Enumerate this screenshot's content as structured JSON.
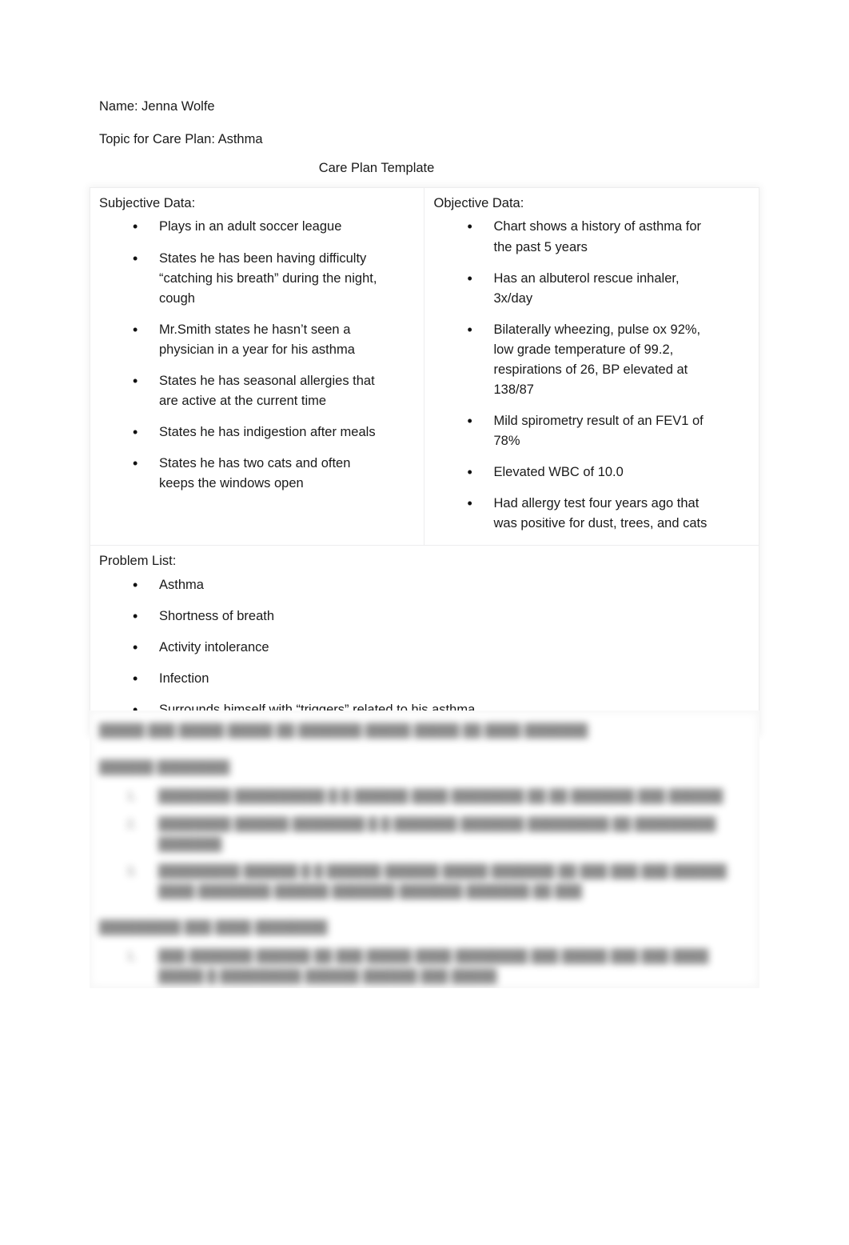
{
  "document": {
    "name_line": "Name: Jenna Wolfe",
    "topic_line": "Topic for Care Plan: Asthma",
    "title": "Care Plan Template"
  },
  "table": {
    "subjective": {
      "heading": "Subjective Data:",
      "items": [
        "Plays in an adult soccer league",
        "States he has been having difficulty “catching his breath” during the night, cough",
        "Mr.Smith states he hasn’t seen a physician in a year for his asthma",
        "States he has seasonal allergies that are active at the current time",
        "States he has indigestion after meals",
        "States he has two cats and often keeps the windows open"
      ]
    },
    "objective": {
      "heading": "Objective Data:",
      "items": [
        "Chart shows a history of asthma for the past 5 years",
        "Has an albuterol rescue inhaler, 3x/day",
        "Bilaterally wheezing, pulse ox 92%, low grade temperature of 99.2, respirations of 26, BP elevated at 138/87",
        "Mild spirometry result of an FEV1 of 78%",
        "Elevated WBC of 10.0",
        "Had allergy test four years ago that was positive for dust, trees, and cats"
      ]
    },
    "problem_list": {
      "heading": "Problem List:",
      "items": [
        "Asthma",
        "Shortness of breath",
        "Activity intolerance",
        "Infection",
        "Surrounds himself with “triggers” related to his asthma"
      ]
    }
  },
  "redacted": {
    "note": "blurred-illegible",
    "paragraph": "█████ ███ █████ █████ ██ ███████ █████ █████ ██ ████ ███████",
    "subhead_one": "██████ ████████",
    "list_one": [
      "████████ ██████████ █ █ ██████ ████ ████████ ██ ██ ███████ ███ ██████",
      "████████ ██████ ████████ █ █ ███████ ███████ █████████ ██ █████████ ███████",
      "█████████ ██████ █ █ ██████ ██████ █████ ███████ ██ ███ ███ ███ ██████ ████ ████████ ██████ ███████ ███████ ███████ ██ ███"
    ],
    "subhead_two": "█████████ ███ ████ ████████",
    "list_two": [
      "███ ███████ ██████ ██ ███ █████ ████ ████████ ███ █████ ███ ███ ████ █████ █ █████████ ██████ ██████ ███ █████"
    ]
  }
}
